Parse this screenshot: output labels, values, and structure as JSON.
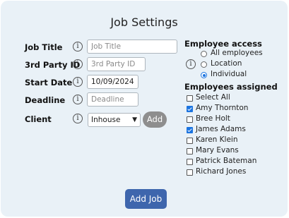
{
  "title": "Job Settings",
  "form": {
    "job_title": {
      "label": "Job Title",
      "value": "",
      "placeholder": "Job Title"
    },
    "third_party_id": {
      "label": "3rd Party ID",
      "value": "",
      "placeholder": "3rd Party ID"
    },
    "start_date": {
      "label": "Start Date",
      "value": "10/09/2024",
      "placeholder": ""
    },
    "deadline": {
      "label": "Deadline",
      "value": "",
      "placeholder": "Deadline"
    },
    "client": {
      "label": "Client",
      "selected": "Inhouse",
      "add_label": "Add"
    },
    "info_glyph": "i"
  },
  "access": {
    "heading": "Employee access",
    "options": [
      {
        "label": "All employees",
        "selected": false
      },
      {
        "label": "Location",
        "selected": false
      },
      {
        "label": "Individual",
        "selected": true
      }
    ]
  },
  "assigned": {
    "heading": "Employees assigned",
    "items": [
      {
        "label": "Select All",
        "checked": false
      },
      {
        "label": "Amy Thornton",
        "checked": true
      },
      {
        "label": "Bree Holt",
        "checked": false
      },
      {
        "label": "James Adams",
        "checked": true
      },
      {
        "label": "Karen Klein",
        "checked": false
      },
      {
        "label": "Mary Evans",
        "checked": false
      },
      {
        "label": "Patrick Bateman",
        "checked": false
      },
      {
        "label": "Richard Jones",
        "checked": false
      }
    ]
  },
  "submit_label": "Add Job",
  "colors": {
    "panel_bg": "#e9f1f7",
    "primary": "#3e66ad",
    "check": "#1b74e0",
    "secondary_button": "#8e8e8e"
  }
}
